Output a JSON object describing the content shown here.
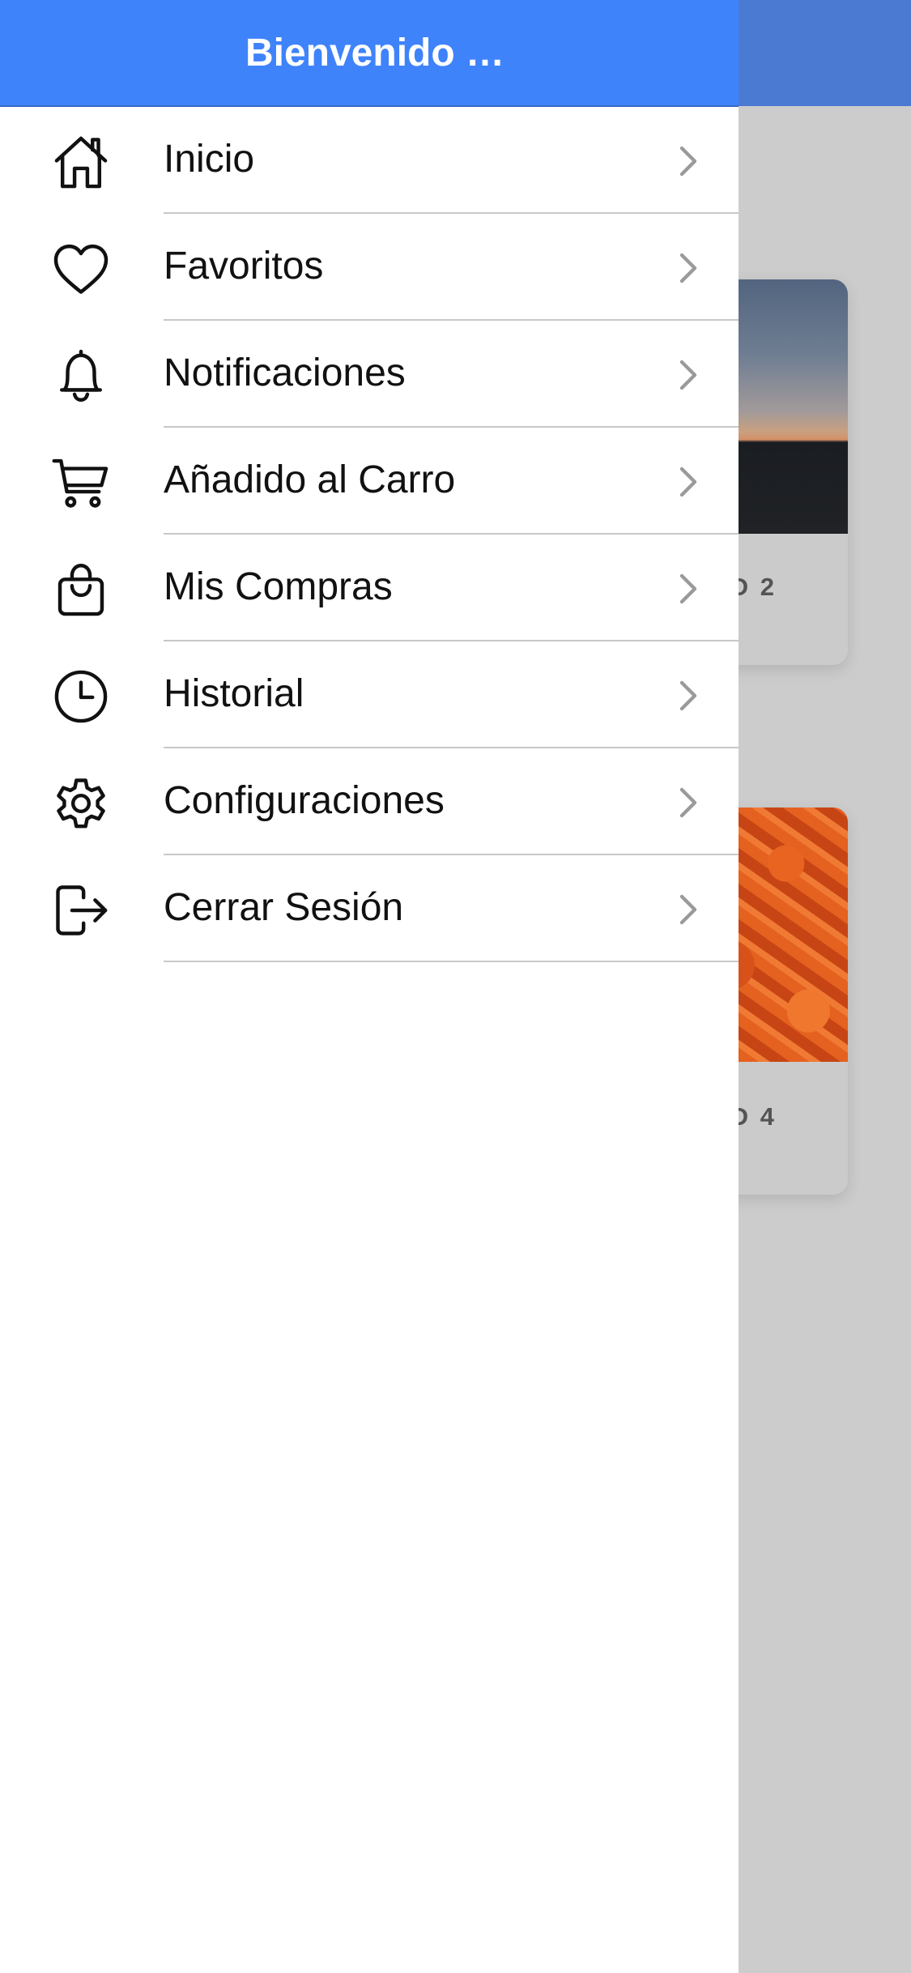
{
  "drawer": {
    "title": "Bienvenido …",
    "items": [
      {
        "label": "Inicio",
        "icon": "home-icon"
      },
      {
        "label": "Favoritos",
        "icon": "heart-icon"
      },
      {
        "label": "Notificaciones",
        "icon": "bell-icon"
      },
      {
        "label": "Añadido al Carro",
        "icon": "cart-icon"
      },
      {
        "label": "Mis Compras",
        "icon": "shopping-bag-icon"
      },
      {
        "label": "Historial",
        "icon": "clock-icon"
      },
      {
        "label": "Configuraciones",
        "icon": "gear-icon"
      },
      {
        "label": "Cerrar Sesión",
        "icon": "logout-icon"
      }
    ]
  },
  "background": {
    "cards": [
      {
        "caption": "D 2"
      },
      {
        "caption": "D 4"
      }
    ]
  },
  "colors": {
    "drawer_header": "#3f83fb",
    "dimmed_header": "#4a7ad2",
    "overlay": "#cccccc"
  }
}
